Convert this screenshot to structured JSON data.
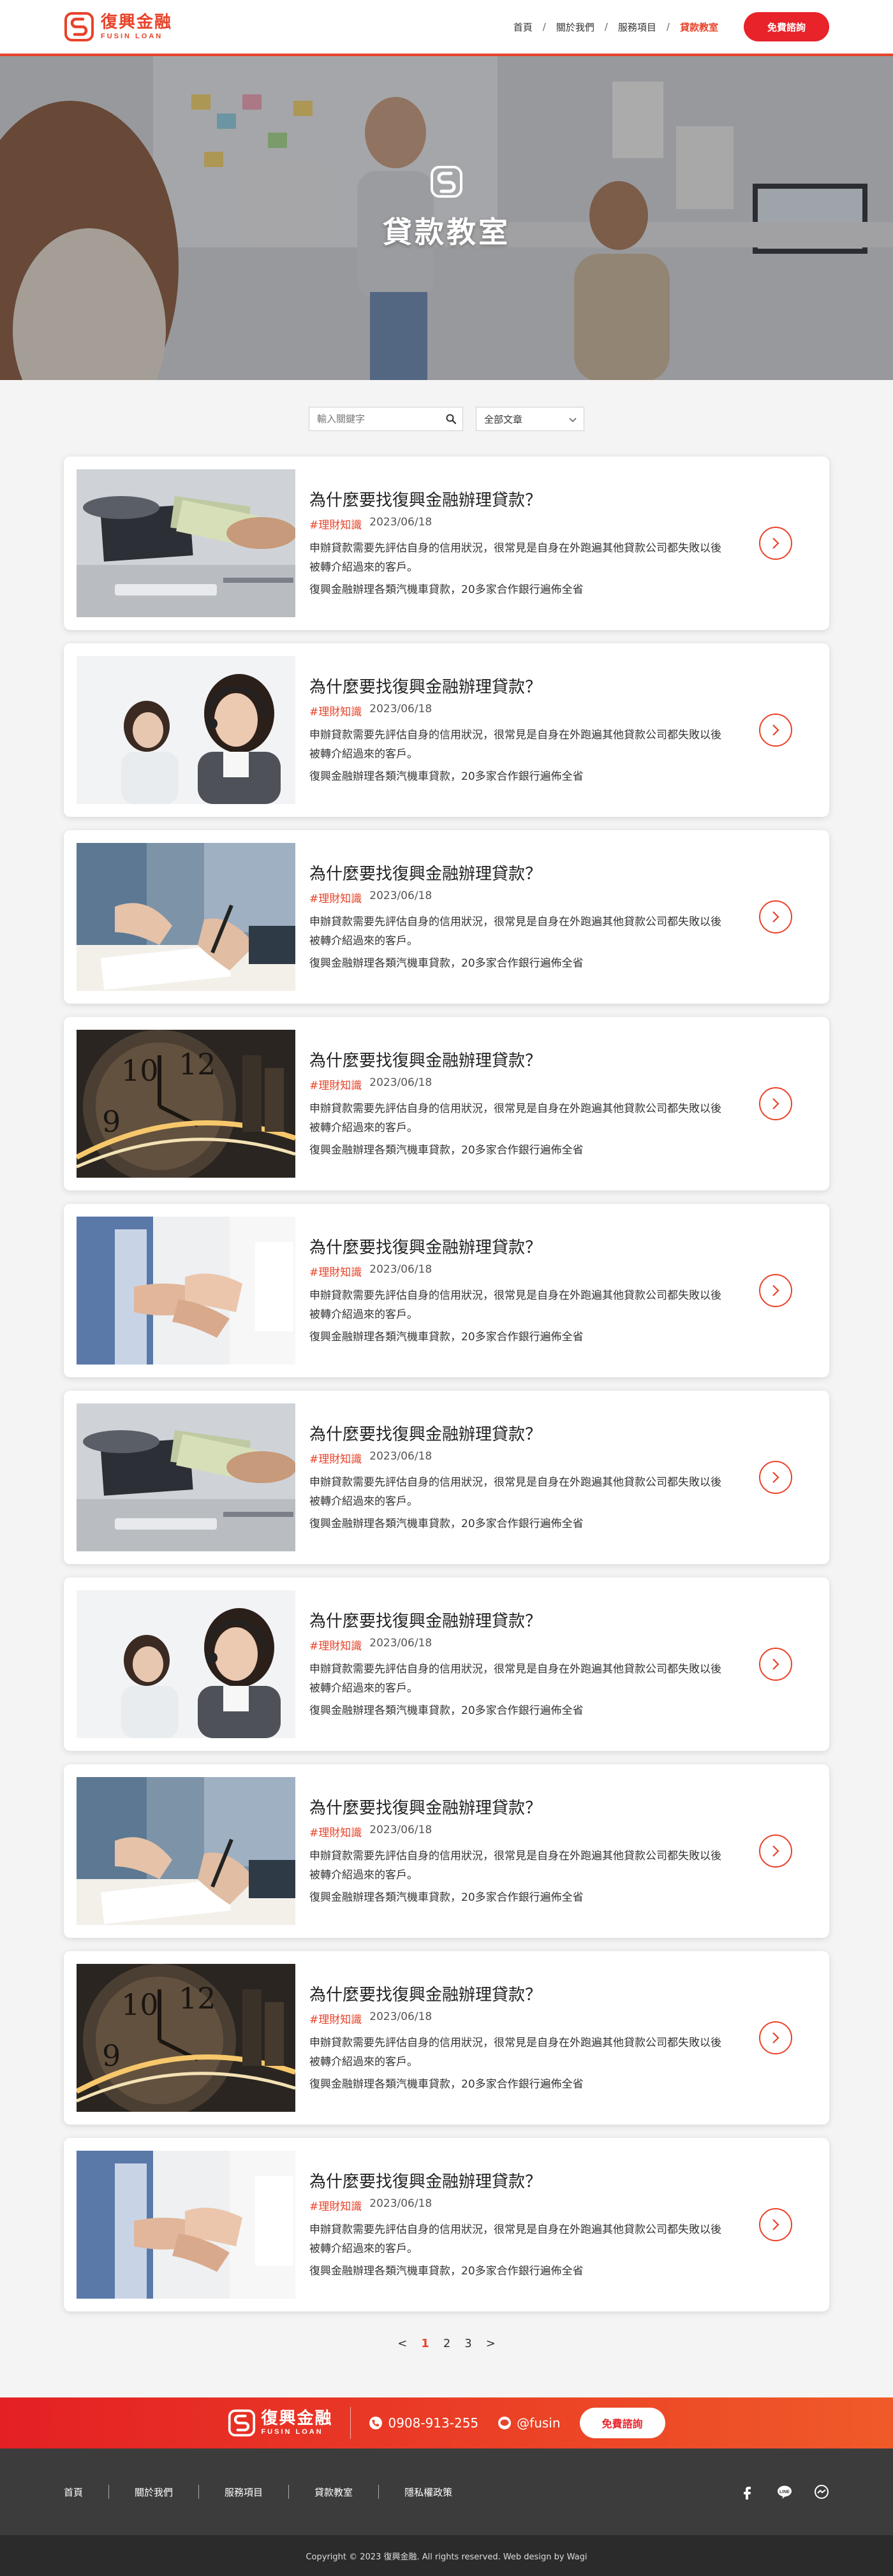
{
  "brand": {
    "name_cn": "復興金融",
    "name_en": "FUSIN LOAN",
    "color": "#e8432a"
  },
  "nav": {
    "items": [
      {
        "label": "首頁"
      },
      {
        "label": "關於我們"
      },
      {
        "label": "服務項目"
      },
      {
        "label": "貸款教室"
      }
    ],
    "active": "貸款教室",
    "cta_label": "免費諮詢"
  },
  "hero": {
    "title": "貸款教室"
  },
  "filter": {
    "search_placeholder": "輸入關鍵字",
    "category_selected": "全部文章"
  },
  "articles": [
    {
      "title": "為什麼要找復興金融辦理貸款？",
      "tag": "#理財知識",
      "date": "2023/06/18",
      "desc": "申辦貸款需要先評估自身的信用狀況，很常見是自身在外跑遍其他貸款公司都失敗以後被轉介紹過來的客戶。",
      "desc2": "復興金融辦理各類汽機車貸款，20多家合作銀行遍佈全省",
      "image": "money-handover"
    },
    {
      "title": "為什麼要找復興金融辦理貸款？",
      "tag": "#理財知識",
      "date": "2023/06/18",
      "desc": "申辦貸款需要先評估自身的信用狀況，很常見是自身在外跑遍其他貸款公司都失敗以後被轉介紹過來的客戶。",
      "desc2": "復興金融辦理各類汽機車貸款，20多家合作銀行遍佈全省",
      "image": "call-center"
    },
    {
      "title": "為什麼要找復興金融辦理貸款？",
      "tag": "#理財知識",
      "date": "2023/06/18",
      "desc": "申辦貸款需要先評估自身的信用狀況，很常見是自身在外跑遍其他貸款公司都失敗以後被轉介紹過來的客戶。",
      "desc2": "復興金融辦理各類汽機車貸款，20多家合作銀行遍佈全省",
      "image": "signing"
    },
    {
      "title": "為什麼要找復興金融辦理貸款？",
      "tag": "#理財知識",
      "date": "2023/06/18",
      "desc": "申辦貸款需要先評估自身的信用狀況，很常見是自身在外跑遍其他貸款公司都失敗以後被轉介紹過來的客戶。",
      "desc2": "復興金融辦理各類汽機車貸款，20多家合作銀行遍佈全省",
      "image": "clock-city"
    },
    {
      "title": "為什麼要找復興金融辦理貸款？",
      "tag": "#理財知識",
      "date": "2023/06/18",
      "desc": "申辦貸款需要先評估自身的信用狀況，很常見是自身在外跑遍其他貸款公司都失敗以後被轉介紹過來的客戶。",
      "desc2": "復興金融辦理各類汽機車貸款，20多家合作銀行遍佈全省",
      "image": "team-hands"
    },
    {
      "title": "為什麼要找復興金融辦理貸款？",
      "tag": "#理財知識",
      "date": "2023/06/18",
      "desc": "申辦貸款需要先評估自身的信用狀況，很常見是自身在外跑遍其他貸款公司都失敗以後被轉介紹過來的客戶。",
      "desc2": "復興金融辦理各類汽機車貸款，20多家合作銀行遍佈全省",
      "image": "money-handover"
    },
    {
      "title": "為什麼要找復興金融辦理貸款？",
      "tag": "#理財知識",
      "date": "2023/06/18",
      "desc": "申辦貸款需要先評估自身的信用狀況，很常見是自身在外跑遍其他貸款公司都失敗以後被轉介紹過來的客戶。",
      "desc2": "復興金融辦理各類汽機車貸款，20多家合作銀行遍佈全省",
      "image": "call-center"
    },
    {
      "title": "為什麼要找復興金融辦理貸款？",
      "tag": "#理財知識",
      "date": "2023/06/18",
      "desc": "申辦貸款需要先評估自身的信用狀況，很常見是自身在外跑遍其他貸款公司都失敗以後被轉介紹過來的客戶。",
      "desc2": "復興金融辦理各類汽機車貸款，20多家合作銀行遍佈全省",
      "image": "signing"
    },
    {
      "title": "為什麼要找復興金融辦理貸款？",
      "tag": "#理財知識",
      "date": "2023/06/18",
      "desc": "申辦貸款需要先評估自身的信用狀況，很常見是自身在外跑遍其他貸款公司都失敗以後被轉介紹過來的客戶。",
      "desc2": "復興金融辦理各類汽機車貸款，20多家合作銀行遍佈全省",
      "image": "clock-city"
    },
    {
      "title": "為什麼要找復興金融辦理貸款？",
      "tag": "#理財知識",
      "date": "2023/06/18",
      "desc": "申辦貸款需要先評估自身的信用狀況，很常見是自身在外跑遍其他貸款公司都失敗以後被轉介紹過來的客戶。",
      "desc2": "復興金融辦理各類汽機車貸款，20多家合作銀行遍佈全省",
      "image": "team-hands"
    }
  ],
  "pagination": {
    "prev": "<",
    "pages": [
      "1",
      "2",
      "3"
    ],
    "active": "1",
    "next": ">"
  },
  "footer_band": {
    "phone": "0908-913-255",
    "line_id": "@fusin",
    "cta_label": "免費諮詢"
  },
  "footer": {
    "links": [
      {
        "label": "首頁"
      },
      {
        "label": "關於我們"
      },
      {
        "label": "服務項目"
      },
      {
        "label": "貸款教室"
      },
      {
        "label": "隱私權政策"
      }
    ],
    "socials": [
      "facebook-icon",
      "line-icon",
      "messenger-icon"
    ],
    "copyright": "Copyright © 2023 復興金融. All rights reserved. Web design by Wagi"
  }
}
